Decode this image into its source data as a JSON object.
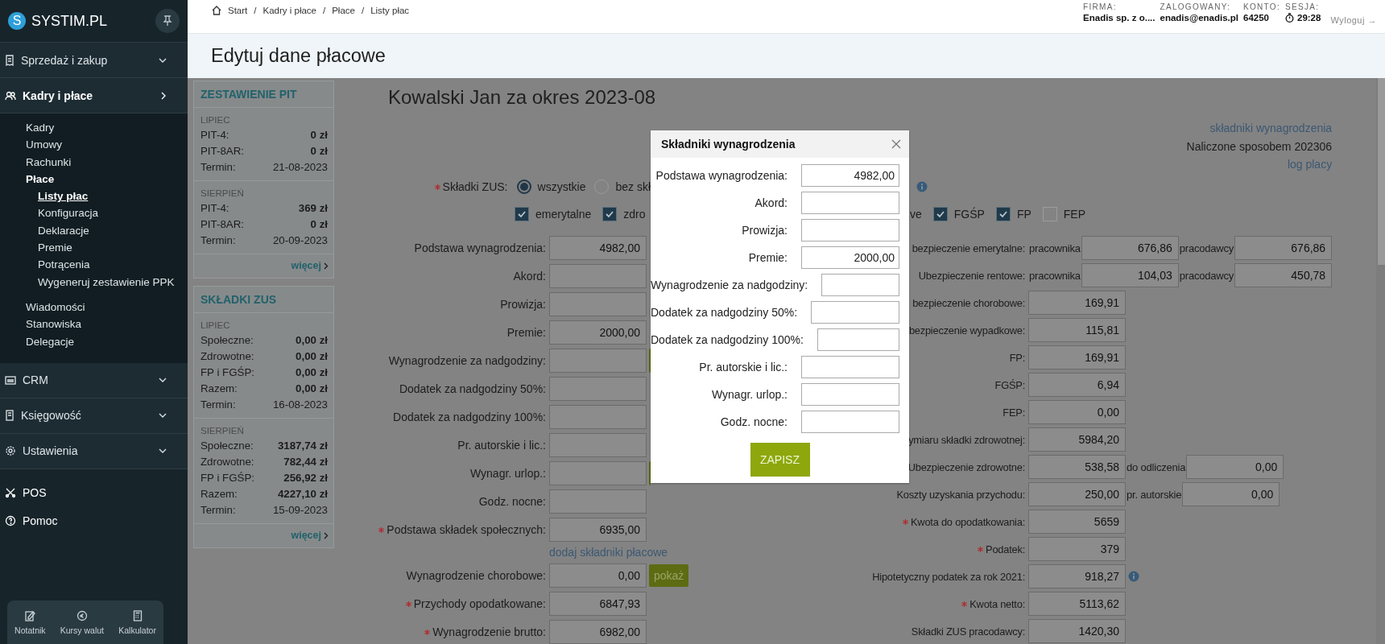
{
  "sidebar": {
    "logo": {
      "letter": "S",
      "name": "SYSTIM.PL"
    },
    "sections": [
      {
        "label": "Sprzedaż i zakup",
        "expanded": false
      },
      {
        "label": "Kadry i płace",
        "expanded": true,
        "children": [
          {
            "label": "Kadry",
            "selected": false,
            "expanded": false
          },
          {
            "label": "Umowy",
            "selected": false,
            "expanded": false
          },
          {
            "label": "Rachunki",
            "selected": false,
            "expanded": false
          },
          {
            "label": "Płace",
            "selected": false,
            "expanded": true,
            "children": [
              {
                "label": "Listy płac",
                "selected": true
              },
              {
                "label": "Konfiguracja",
                "selected": false
              },
              {
                "label": "Deklaracje",
                "selected": false
              },
              {
                "label": "Premie",
                "selected": false
              },
              {
                "label": "Potrącenia",
                "selected": false
              },
              {
                "label": "Wygeneruj zestawienie PPK",
                "selected": false
              }
            ]
          },
          {
            "label": "Wiadomości",
            "selected": false,
            "expanded": false
          },
          {
            "label": "Stanowiska",
            "selected": false,
            "expanded": false
          },
          {
            "label": "Delegacje",
            "selected": false,
            "expanded": false
          }
        ]
      },
      {
        "label": "CRM",
        "expanded": false
      },
      {
        "label": "Księgowość",
        "expanded": false
      },
      {
        "label": "Ustawienia",
        "expanded": false
      }
    ],
    "links": [
      "POS",
      "Pomoc"
    ],
    "tools": [
      "Notatnik",
      "Kursy walut",
      "Kalkulator"
    ]
  },
  "topbar": {
    "breadcrumbs": [
      "Start",
      "Kadry i płace",
      "Płace",
      "Listy płac"
    ],
    "separator": "/",
    "account": [
      {
        "label": "FIRMA:",
        "value": "Enadis sp. z o...."
      },
      {
        "label": "ZALOGOWANY:",
        "value": "enadis@enadis.pl"
      },
      {
        "label": "KONTO:",
        "value": "64250"
      },
      {
        "label": "SESJA:",
        "value": "29:28",
        "kind": "timer"
      }
    ],
    "logout": "Wyloguj →"
  },
  "page_title": "Edytuj dane płacowe",
  "panels": [
    {
      "title": "ZESTAWIENIE PIT",
      "groups": [
        {
          "month": "LIPIEC",
          "rows": [
            {
              "label": "PIT-4:",
              "value": "0 zł",
              "kind": "amount"
            },
            {
              "label": "PIT-8AR:",
              "value": "0 zł",
              "kind": "amount"
            },
            {
              "label": "Termin:",
              "value": "21-08-2023",
              "kind": "date"
            }
          ]
        },
        {
          "month": "SIERPIEŃ",
          "rows": [
            {
              "label": "PIT-4:",
              "value": "369 zł",
              "kind": "amount"
            },
            {
              "label": "PIT-8AR:",
              "value": "0 zł",
              "kind": "amount"
            },
            {
              "label": "Termin:",
              "value": "20-09-2023",
              "kind": "date"
            }
          ]
        }
      ],
      "more": "więcej"
    },
    {
      "title": "SKŁADKI ZUS",
      "groups": [
        {
          "month": "LIPIEC",
          "rows": [
            {
              "label": "Społeczne:",
              "value": "0,00 zł",
              "kind": "amount"
            },
            {
              "label": "Zdrowotne:",
              "value": "0,00 zł",
              "kind": "amount"
            },
            {
              "label": "FP i FGŚP:",
              "value": "0,00 zł",
              "kind": "amount"
            },
            {
              "label": "Razem:",
              "value": "0,00 zł",
              "kind": "amount"
            },
            {
              "label": "Termin:",
              "value": "16-08-2023",
              "kind": "date"
            }
          ]
        },
        {
          "month": "SIERPIEŃ",
          "rows": [
            {
              "label": "Społeczne:",
              "value": "3187,74 zł",
              "kind": "amount"
            },
            {
              "label": "Zdrowotne:",
              "value": "782,44 zł",
              "kind": "amount"
            },
            {
              "label": "FP i FGŚP:",
              "value": "256,92 zł",
              "kind": "amount"
            },
            {
              "label": "Razem:",
              "value": "4227,10 zł",
              "kind": "amount"
            },
            {
              "label": "Termin:",
              "value": "15-09-2023",
              "kind": "date"
            }
          ]
        }
      ],
      "more": "więcej"
    }
  ],
  "form": {
    "heading": "Kowalski Jan za okres 2023-08",
    "components_link": "składniki wynagrodzenia",
    "method": "Naliczone sposobem 202306",
    "log_link": "log placy",
    "zus": {
      "label": "Składki ZUS:",
      "required": true,
      "options": [
        {
          "label": "wszystkie",
          "selected": true
        },
        {
          "label": "bez skł",
          "selected": false
        }
      ]
    },
    "contributions_left": [
      {
        "label": "emerytalne",
        "checked": true
      },
      {
        "label": "zdro",
        "checked": true
      }
    ],
    "contributions_fragment": "ve",
    "contributions_right": [
      {
        "label": "FGŚP",
        "checked": true
      },
      {
        "label": "FP",
        "checked": true
      },
      {
        "label": "FEP",
        "checked": false
      }
    ],
    "left_rows": [
      {
        "kind": "field",
        "label": "Podstawa wynagrodzenia:",
        "value": "4982,00",
        "required": false
      },
      {
        "kind": "field",
        "label": "Akord:",
        "required": false
      },
      {
        "kind": "field",
        "label": "Prowizja:",
        "required": false
      },
      {
        "kind": "field",
        "label": "Premie:",
        "value": "2000,00",
        "required": false
      },
      {
        "kind": "field-hidden-button",
        "label": "Wynagrodzenie za nadgodziny:",
        "required": false
      },
      {
        "kind": "field",
        "label": "Dodatek za nadgodziny 50%:",
        "required": false
      },
      {
        "kind": "field",
        "label": "Dodatek za nadgodziny 100%:",
        "required": false
      },
      {
        "kind": "field",
        "label": "Pr. autorskie i lic.:",
        "required": false
      },
      {
        "kind": "field-hidden-button",
        "label": "Wynagr. urlop.:",
        "required": false
      },
      {
        "kind": "field",
        "label": "Godz. nocne:",
        "required": false
      },
      {
        "kind": "field",
        "label": "Podstawa składek społecznych:",
        "value": "6935,00",
        "required": true
      },
      {
        "kind": "link",
        "label": "dodaj składniki płacowe"
      },
      {
        "kind": "field-button",
        "label": "Wynagrodzenie chorobowe:",
        "value": "0,00",
        "required": false,
        "button": "pokaż"
      },
      {
        "kind": "field",
        "label": "Przychody opodatkowane:",
        "value": "6847,93",
        "required": true
      },
      {
        "kind": "field",
        "label": "Wynagrodzenie brutto:",
        "value": "6982,00",
        "required": true
      }
    ],
    "right_rows": [
      {
        "kind": "pair",
        "label": "bezpieczenie emerytalne:",
        "fields": [
          {
            "prefix": "pracownika",
            "value": "676,86"
          },
          {
            "prefix": "pracodawcy",
            "value": "676,86"
          }
        ]
      },
      {
        "kind": "pair",
        "label": "Ubezpieczenie rentowe:",
        "required": false,
        "fields": [
          {
            "prefix": "pracownika",
            "value": "104,03"
          },
          {
            "prefix": "pracodawcy",
            "value": "450,78"
          }
        ]
      },
      {
        "kind": "single",
        "label": "bezpieczenie chorobowe:",
        "value": "169,91"
      },
      {
        "kind": "single",
        "label": "bezpieczenie wypadkowe:",
        "value": "115,81"
      },
      {
        "kind": "single",
        "label": "FP:",
        "value": "169,91",
        "required": false
      },
      {
        "kind": "single",
        "label": "FGŚP:",
        "value": "6,94",
        "required": false
      },
      {
        "kind": "single",
        "label": "FEP:",
        "value": "0,00",
        "required": false
      },
      {
        "kind": "single",
        "label": "ymiaru składki zdrowotnej:",
        "value": "5984,20"
      },
      {
        "kind": "pair",
        "label": "Ubezpieczenie zdrowotne:",
        "fields": [
          {
            "value": "538,58"
          },
          {
            "prefix": "do odliczenia",
            "value": "0,00"
          }
        ]
      },
      {
        "kind": "pair",
        "label": "Koszty uzyskania przychodu:",
        "required": false,
        "fields": [
          {
            "value": "250,00"
          },
          {
            "prefix": "pr. autorskie",
            "value": "0,00"
          }
        ]
      },
      {
        "kind": "single",
        "label": "Kwota do opodatkowania:",
        "value": "5659",
        "required": true
      },
      {
        "kind": "single",
        "label": "Podatek:",
        "value": "379",
        "required": true
      },
      {
        "kind": "info",
        "label": "Hipotetyczny podatek za rok 2021:",
        "value": "918,27",
        "required": false
      },
      {
        "kind": "single",
        "label": "Kwota netto:",
        "value": "5113,62",
        "required": true
      },
      {
        "kind": "single",
        "label": "Składki ZUS pracodawcy:",
        "value": "1420,30",
        "required": false
      }
    ]
  },
  "modal": {
    "title": "Składniki wynagrodzenia",
    "rows": [
      {
        "label": "Podstawa wynagrodzenia:",
        "value": "4982,00"
      },
      {
        "label": "Akord:"
      },
      {
        "label": "Prowizja:"
      },
      {
        "label": "Premie:",
        "value": "2000,00"
      },
      {
        "label": "Wynagrodzenie za nadgodziny:"
      },
      {
        "label": "Dodatek za nadgodziny 50%:"
      },
      {
        "label": "Dodatek za nadgodziny 100%:"
      },
      {
        "label": "Pr. autorskie i lic.:"
      },
      {
        "label": "Wynagr. urlop.:"
      },
      {
        "label": "Godz. nocne:"
      }
    ],
    "submit": "ZAPISZ"
  }
}
